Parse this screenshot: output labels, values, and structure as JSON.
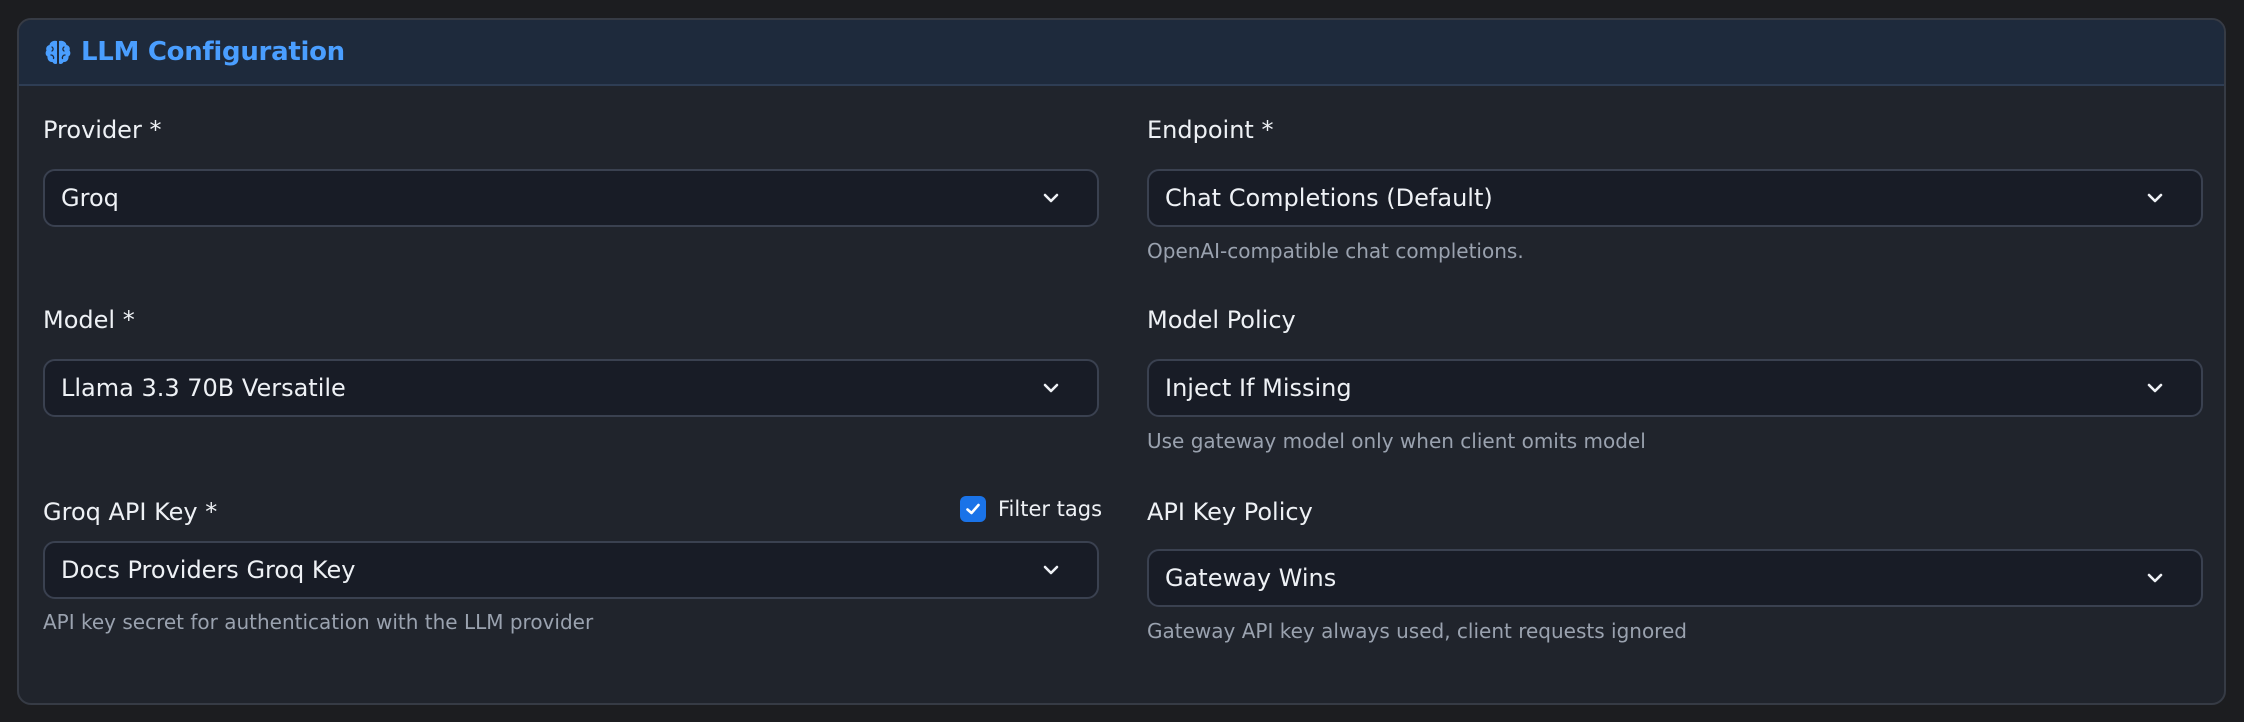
{
  "header": {
    "title": "LLM Configuration",
    "icon": "brain-icon",
    "accent_color": "#4a9eff"
  },
  "left": {
    "provider": {
      "label": "Provider *",
      "value": "Groq"
    },
    "model": {
      "label": "Model *",
      "value": "Llama 3.3 70B Versatile"
    },
    "api_key": {
      "label": "Groq API Key *",
      "value": "Docs Providers Groq Key",
      "help": "API key secret for authentication with the LLM provider",
      "filter_tags": {
        "label": "Filter tags",
        "checked": true
      }
    }
  },
  "right": {
    "endpoint": {
      "label": "Endpoint *",
      "value": "Chat Completions (Default)",
      "help": "OpenAI-compatible chat completions."
    },
    "model_policy": {
      "label": "Model Policy",
      "value": "Inject If Missing",
      "help": "Use gateway model only when client omits model"
    },
    "api_key_policy": {
      "label": "API Key Policy",
      "value": "Gateway Wins",
      "help": "Gateway API key always used, client requests ignored"
    }
  },
  "icons": {
    "dropdown": "chevron-down-icon",
    "checkbox": "check-icon"
  },
  "colors": {
    "checkbox": "#1a73e8"
  }
}
